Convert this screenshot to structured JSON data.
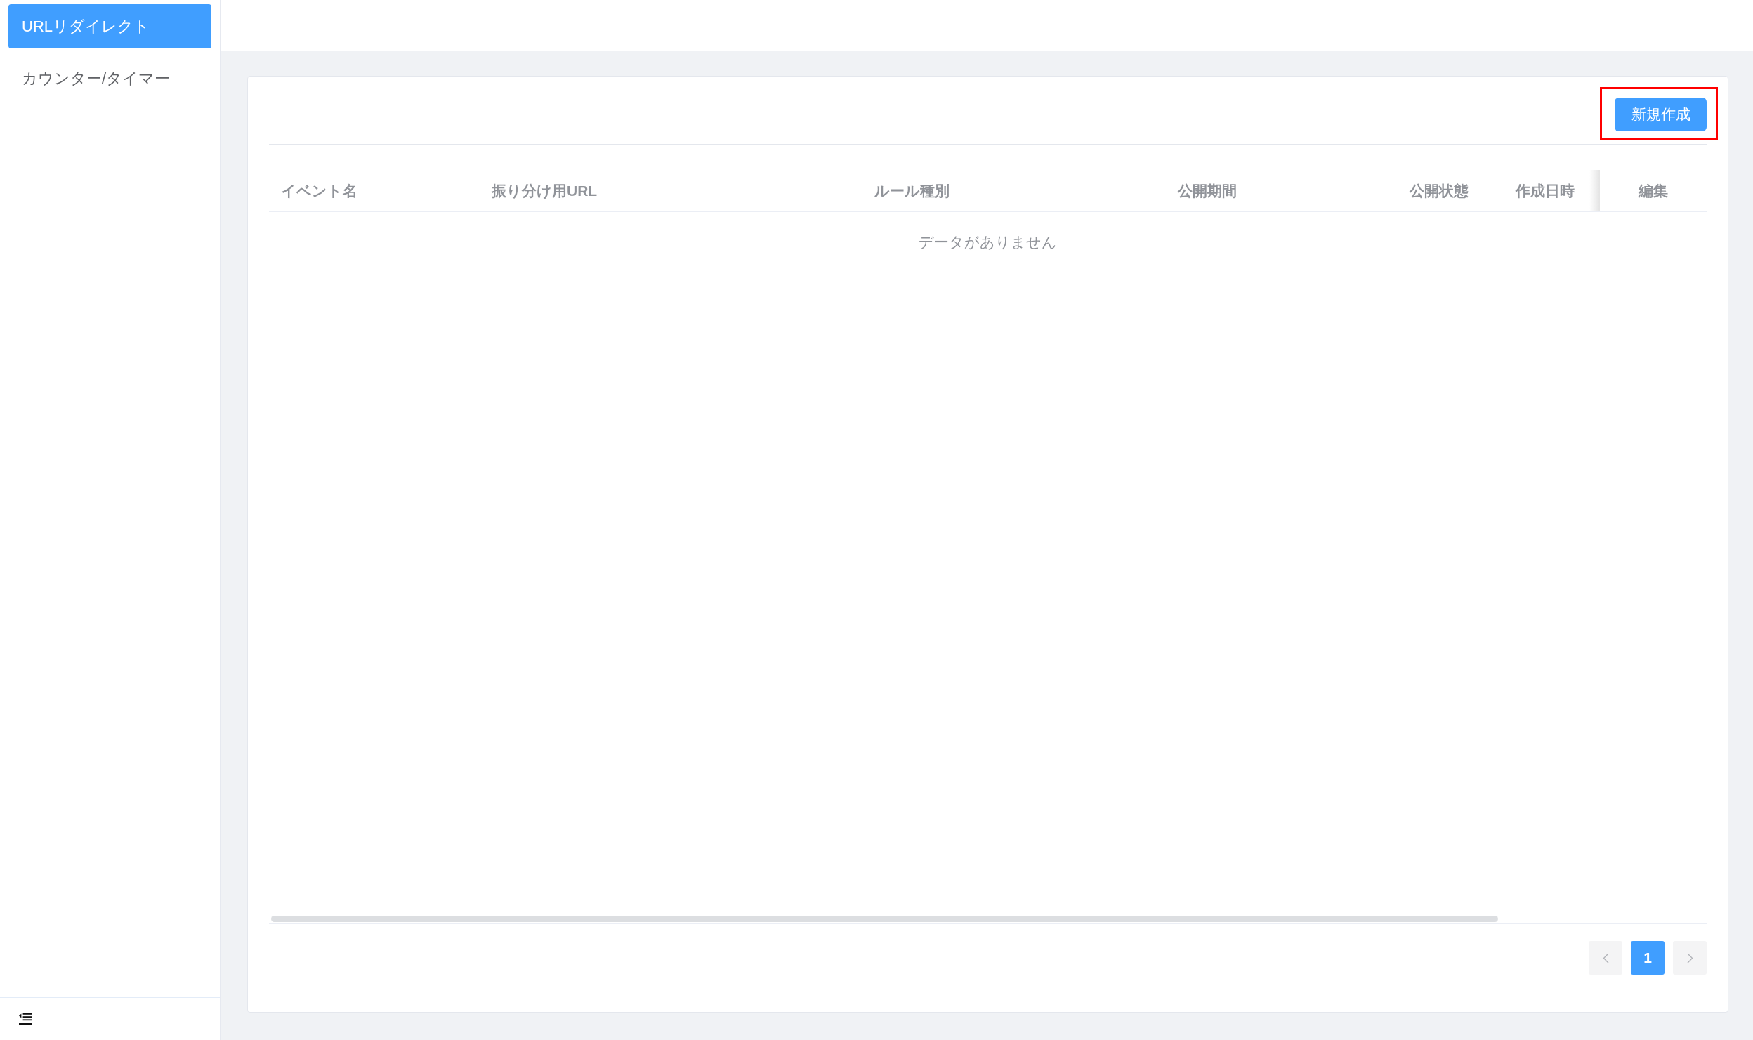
{
  "sidebar": {
    "items": [
      {
        "label": "URLリダイレクト",
        "selected": true
      },
      {
        "label": "カウンター/タイマー",
        "selected": false
      }
    ]
  },
  "toolbar": {
    "create_button": {
      "label": "新規作成",
      "highlighted": true
    }
  },
  "table": {
    "columns": [
      "イベント名",
      "振り分け用URL",
      "ルール種別",
      "公開期間",
      "公開状態",
      "作成日時",
      "編集"
    ],
    "empty_text": "データがありません"
  },
  "pagination": {
    "prev": {
      "disabled": true
    },
    "pages": [
      {
        "label": "1",
        "selected": true
      }
    ],
    "next": {
      "disabled": true
    }
  }
}
